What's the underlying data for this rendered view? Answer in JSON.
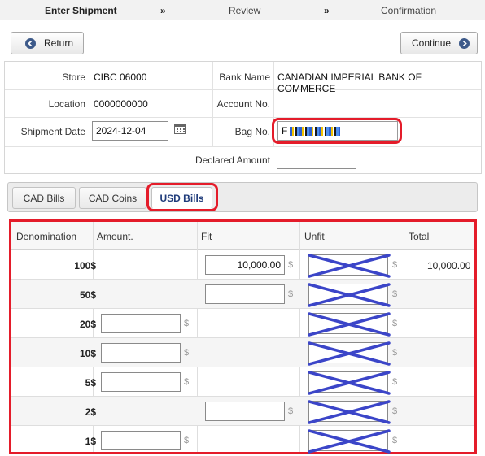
{
  "steps": {
    "step1": "Enter Shipment",
    "arrow1": "»",
    "step2": "Review",
    "arrow2": "»",
    "step3": "Confirmation"
  },
  "toolbar": {
    "return_label": "Return",
    "continue_label": "Continue"
  },
  "shipment": {
    "store_label": "Store",
    "store_value": "CIBC 06000",
    "bank_name_label": "Bank Name",
    "bank_name_value": "CANADIAN IMPERIAL BANK OF COMMERCE",
    "location_label": "Location",
    "location_value": "0000000000",
    "account_label": "Account No.",
    "account_value": "",
    "shipment_date_label": "Shipment Date",
    "shipment_date_value": "2024-12-04",
    "bag_no_label": "Bag No.",
    "bag_no_value": "F",
    "declared_amount_label": "Declared Amount",
    "declared_amount_value": ""
  },
  "tabs": [
    {
      "label": "CAD Bills"
    },
    {
      "label": "CAD Coins"
    },
    {
      "label": "USD Bills"
    }
  ],
  "active_tab": "USD Bills",
  "table": {
    "headers": [
      "Denomination",
      "Amount.",
      "Fit",
      "Unfit",
      "Total"
    ],
    "currency_symbol": "$",
    "rows": [
      {
        "denomination": "100$",
        "amount": null,
        "fit": "10,000.00",
        "total": "10,000.00"
      },
      {
        "denomination": "50$",
        "amount": null,
        "fit": "",
        "total": ""
      },
      {
        "denomination": "20$",
        "amount": "",
        "fit": null,
        "total": ""
      },
      {
        "denomination": "10$",
        "amount": "",
        "fit": null,
        "total": ""
      },
      {
        "denomination": "5$",
        "amount": "",
        "fit": null,
        "total": ""
      },
      {
        "denomination": "2$",
        "amount": null,
        "fit": "",
        "total": ""
      },
      {
        "denomination": "1$",
        "amount": "",
        "fit": null,
        "total": ""
      }
    ]
  },
  "colors": {
    "highlight": "#e41c2a",
    "strike": "#3b45c8",
    "active_tab_text": "#1f3b7a",
    "button_icon": "#3d5a8a"
  },
  "icons": {
    "return": "arrow-left-circle-icon",
    "continue": "arrow-right-circle-icon",
    "calendar": "calendar-icon"
  }
}
